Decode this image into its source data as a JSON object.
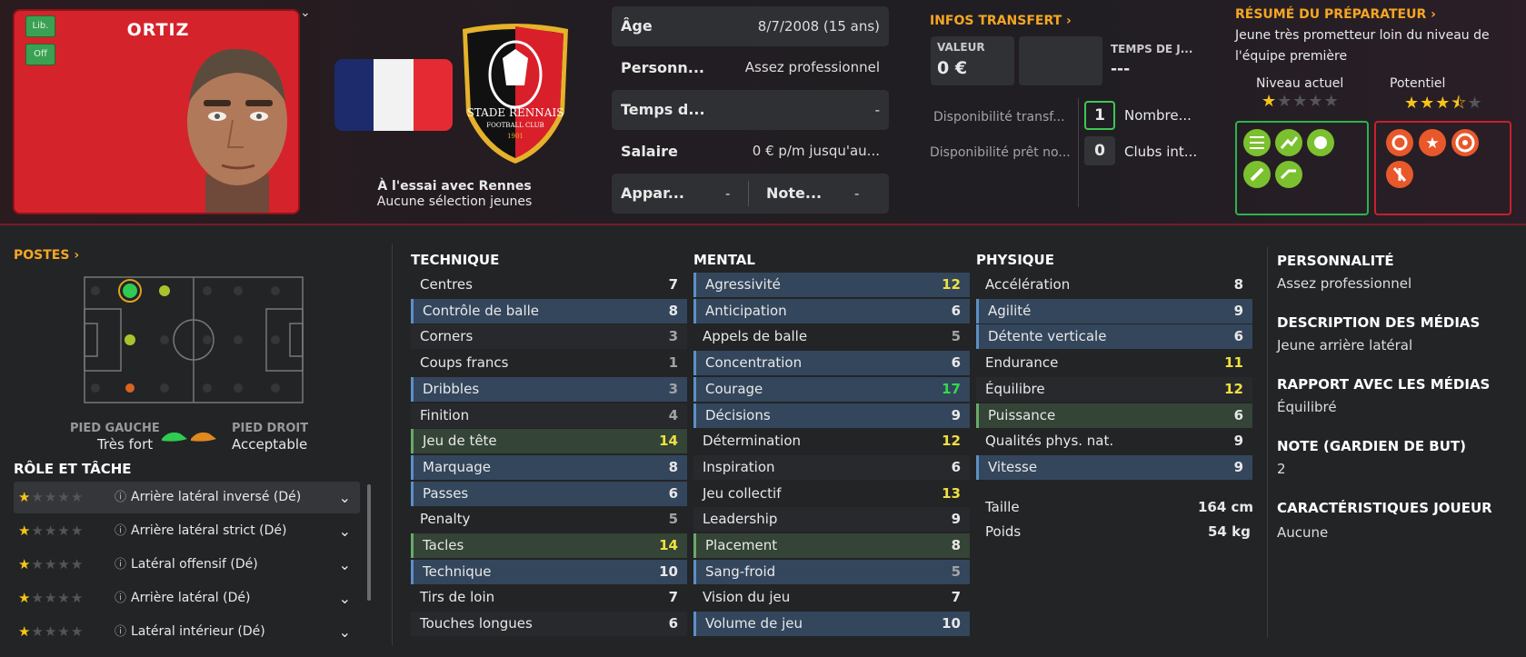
{
  "player": {
    "name": "ORTIZ",
    "tag_lib": "Lib.",
    "tag_off": "Off",
    "club_status": "À l'essai avec Rennes",
    "youth": "Aucune sélection jeunes",
    "club_name": "STADE RENNAIS",
    "club_sub": "FOOTBALL CLUB",
    "club_year": "1901"
  },
  "info": {
    "age_label": "Âge",
    "age_value": "8/7/2008 (15 ans)",
    "pers_label": "Personn...",
    "pers_value": "Assez professionnel",
    "time_label": "Temps d...",
    "time_value": "-",
    "salary_label": "Salaire",
    "salary_value": "0 € p/m jusqu'au...",
    "app_label": "Appar...",
    "app_value": "-",
    "note_label": "Note...",
    "note_value": "-"
  },
  "transfer": {
    "title": "INFOS TRANSFERT",
    "valeur_label": "VALEUR",
    "valeur_value": "0 €",
    "temps_label": "TEMPS DE J...",
    "temps_value": "---",
    "dispo_transf": "Disponibilité transf...",
    "dispo_pret": "Disponibilité prêt no...",
    "nombre_count": "1",
    "nombre_label": "Nombre...",
    "clubs_count": "0",
    "clubs_label": "Clubs int..."
  },
  "scout": {
    "title": "RÉSUMÉ DU PRÉPARATEUR",
    "summary": "Jeune très prometteur loin du niveau de l'équipe première",
    "current_label": "Niveau actuel",
    "potential_label": "Potentiel",
    "current_stars": 1,
    "potential_stars": 3.5
  },
  "positions": {
    "title": "POSTES",
    "left_foot_label": "PIED GAUCHE",
    "left_foot_value": "Très fort",
    "right_foot_label": "PIED DROIT",
    "right_foot_value": "Acceptable"
  },
  "roles": {
    "title": "RÔLE ET TÂCHE",
    "items": [
      {
        "label": "Arrière latéral inversé (Dé)"
      },
      {
        "label": "Arrière latéral strict (Dé)"
      },
      {
        "label": "Latéral offensif (Dé)"
      },
      {
        "label": "Arrière latéral (Dé)"
      },
      {
        "label": "Latéral intérieur (Dé)"
      }
    ]
  },
  "technique": {
    "title": "TECHNIQUE",
    "items": [
      {
        "name": "Centres",
        "value": "7"
      },
      {
        "name": "Contrôle de balle",
        "value": "8"
      },
      {
        "name": "Corners",
        "value": "3"
      },
      {
        "name": "Coups francs",
        "value": "1"
      },
      {
        "name": "Dribbles",
        "value": "3"
      },
      {
        "name": "Finition",
        "value": "4"
      },
      {
        "name": "Jeu de tête",
        "value": "14"
      },
      {
        "name": "Marquage",
        "value": "8"
      },
      {
        "name": "Passes",
        "value": "6"
      },
      {
        "name": "Penalty",
        "value": "5"
      },
      {
        "name": "Tacles",
        "value": "14"
      },
      {
        "name": "Technique",
        "value": "10"
      },
      {
        "name": "Tirs de loin",
        "value": "7"
      },
      {
        "name": "Touches longues",
        "value": "6"
      }
    ]
  },
  "mental": {
    "title": "MENTAL",
    "items": [
      {
        "name": "Agressivité",
        "value": "12"
      },
      {
        "name": "Anticipation",
        "value": "6"
      },
      {
        "name": "Appels de balle",
        "value": "5"
      },
      {
        "name": "Concentration",
        "value": "6"
      },
      {
        "name": "Courage",
        "value": "17"
      },
      {
        "name": "Décisions",
        "value": "9"
      },
      {
        "name": "Détermination",
        "value": "12"
      },
      {
        "name": "Inspiration",
        "value": "6"
      },
      {
        "name": "Jeu collectif",
        "value": "13"
      },
      {
        "name": "Leadership",
        "value": "9"
      },
      {
        "name": "Placement",
        "value": "8"
      },
      {
        "name": "Sang-froid",
        "value": "5"
      },
      {
        "name": "Vision du jeu",
        "value": "7"
      },
      {
        "name": "Volume de jeu",
        "value": "10"
      }
    ]
  },
  "physique": {
    "title": "PHYSIQUE",
    "items": [
      {
        "name": "Accélération",
        "value": "8"
      },
      {
        "name": "Agilité",
        "value": "9"
      },
      {
        "name": "Détente verticale",
        "value": "6"
      },
      {
        "name": "Endurance",
        "value": "11"
      },
      {
        "name": "Équilibre",
        "value": "12"
      },
      {
        "name": "Puissance",
        "value": "6"
      },
      {
        "name": "Qualités phys. nat.",
        "value": "9"
      },
      {
        "name": "Vitesse",
        "value": "9"
      }
    ],
    "height_label": "Taille",
    "height_value": "164 cm",
    "weight_label": "Poids",
    "weight_value": "54 kg"
  },
  "profile": {
    "personality_title": "PERSONNALITÉ",
    "personality_value": "Assez professionnel",
    "media_desc_title": "DESCRIPTION DES MÉDIAS",
    "media_desc_value": "Jeune arrière latéral",
    "media_rel_title": "RAPPORT AVEC LES MÉDIAS",
    "media_rel_value": "Équilibré",
    "gk_title": "NOTE (GARDIEN DE BUT)",
    "gk_value": "2",
    "traits_title": "CARACTÉRISTIQUES JOUEUR",
    "traits_value": "Aucune"
  },
  "colors": {
    "accent": "#f5a623",
    "red": "#d5232b",
    "green": "#37d84c",
    "yellow": "#f0e040"
  }
}
